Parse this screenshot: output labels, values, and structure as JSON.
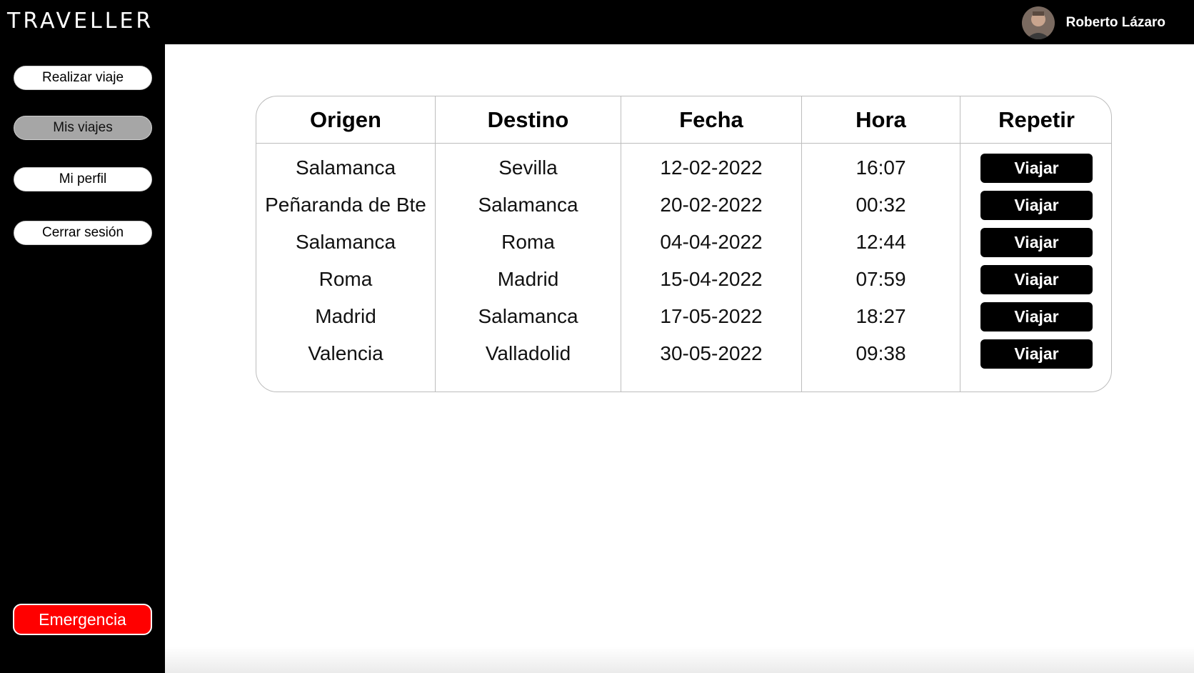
{
  "app": {
    "logo": "TRAVELLER"
  },
  "user": {
    "name": "Roberto Lázaro"
  },
  "sidebar": {
    "items": [
      {
        "label": "Realizar viaje",
        "active": false
      },
      {
        "label": "Mis viajes",
        "active": true
      },
      {
        "label": "Mi perfil",
        "active": false
      },
      {
        "label": "Cerrar sesión",
        "active": false
      }
    ],
    "emergency_label": "Emergencia"
  },
  "table": {
    "headers": [
      "Origen",
      "Destino",
      "Fecha",
      "Hora",
      "Repetir"
    ],
    "rows": [
      {
        "origen": "Salamanca",
        "destino": "Sevilla",
        "fecha": "12-02-2022",
        "hora": "16:07",
        "action": "Viajar"
      },
      {
        "origen": "Peñaranda de Bte",
        "destino": "Salamanca",
        "fecha": "20-02-2022",
        "hora": "00:32",
        "action": "Viajar"
      },
      {
        "origen": "Salamanca",
        "destino": "Roma",
        "fecha": "04-04-2022",
        "hora": "12:44",
        "action": "Viajar"
      },
      {
        "origen": "Roma",
        "destino": "Madrid",
        "fecha": "15-04-2022",
        "hora": "07:59",
        "action": "Viajar"
      },
      {
        "origen": "Madrid",
        "destino": "Salamanca",
        "fecha": "17-05-2022",
        "hora": "18:27",
        "action": "Viajar"
      },
      {
        "origen": "Valencia",
        "destino": "Valladolid",
        "fecha": "30-05-2022",
        "hora": "09:38",
        "action": "Viajar"
      }
    ]
  },
  "colors": {
    "sidebar_bg": "#000000",
    "active_nav": "#a6a6a6",
    "emergency": "#ff0000",
    "action_button": "#000000"
  }
}
